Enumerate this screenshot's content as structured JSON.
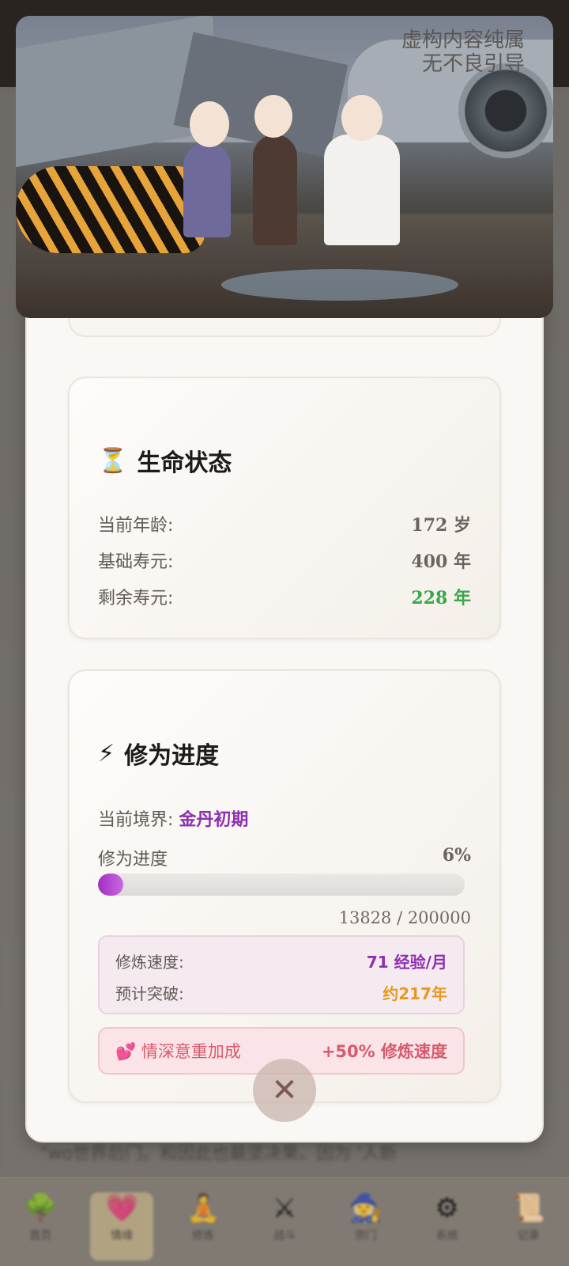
{
  "video": {
    "watermark_line1": "虚构内容纯属",
    "watermark_line2": "无不良引导"
  },
  "background": {
    "story_text": "“wo世界后门。和因此也最坚决果。因为 ‘人新"
  },
  "life_status": {
    "icon": "hourglass-icon",
    "title": "生命状态",
    "rows": [
      {
        "label": "当前年龄:",
        "value": "172 岁"
      },
      {
        "label": "基础寿元:",
        "value": "400 年"
      },
      {
        "label": "剩余寿元:",
        "value": "228 年"
      }
    ]
  },
  "cultivation": {
    "icon": "lightning-icon",
    "title": "修为进度",
    "realm_label": "当前境界:",
    "realm_value": "金丹初期",
    "progress_label": "修为进度",
    "progress_percent_text": "6%",
    "progress_fraction": 0.07,
    "exp_text": "13828 / 200000",
    "speed_label": "修炼速度:",
    "speed_value": "71 经验/月",
    "breakthrough_label": "预计突破:",
    "breakthrough_value": "约217年",
    "bonus_icon": "hearts-icon",
    "bonus_label": "情深意重加成",
    "bonus_value": "+50% 修炼速度"
  },
  "close_button": {
    "label": "✕"
  },
  "bottom_nav": [
    {
      "icon": "tree-icon",
      "glyph": "🌳",
      "label": "首页"
    },
    {
      "icon": "heart-icon",
      "glyph": "💗",
      "label": "情缘"
    },
    {
      "icon": "person-icon",
      "glyph": "🧘",
      "label": "修炼"
    },
    {
      "icon": "swords-icon",
      "glyph": "⚔",
      "label": "战斗"
    },
    {
      "icon": "wizard-icon",
      "glyph": "🧙",
      "label": "宗门"
    },
    {
      "icon": "gear-icon",
      "glyph": "⚙",
      "label": "系统"
    },
    {
      "icon": "scroll-icon",
      "glyph": "📜",
      "label": "记录"
    }
  ],
  "colors": {
    "realm": "#8f2fb0",
    "remaining_life": "#3aa64a",
    "breakthrough": "#e59a1f",
    "bonus": "#d65b6e",
    "progress_fill": "#a12ec0"
  }
}
